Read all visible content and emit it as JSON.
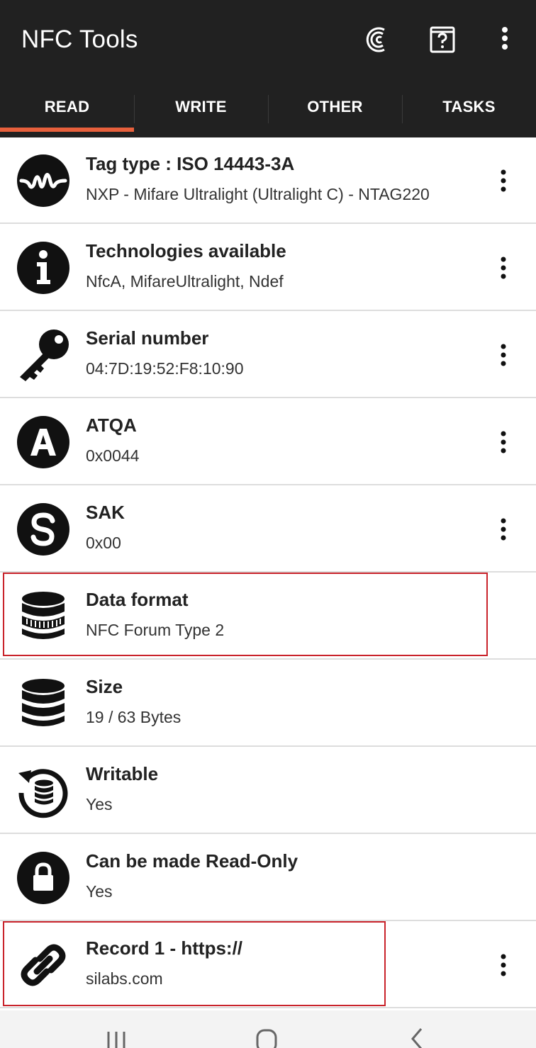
{
  "app": {
    "title": "NFC Tools",
    "accent_color": "#e8603c",
    "appbar_color": "#212121",
    "highlight_color": "#c9232b"
  },
  "toolbar": {
    "icons": [
      "pro-version-icon",
      "help-book-icon",
      "overflow-menu-icon"
    ]
  },
  "tabs": [
    {
      "label": "READ",
      "selected": true
    },
    {
      "label": "WRITE",
      "selected": false
    },
    {
      "label": "OTHER",
      "selected": false
    },
    {
      "label": "TASKS",
      "selected": false
    }
  ],
  "rows": [
    {
      "icon": "waveform-icon",
      "title": "Tag type : ISO 14443-3A",
      "value": "NXP - Mifare Ultralight (Ultralight C) - NTAG220",
      "has_menu": true
    },
    {
      "icon": "info-icon",
      "title": "Technologies available",
      "value": "NfcA, MifareUltralight, Ndef",
      "has_menu": true
    },
    {
      "icon": "key-icon",
      "title": "Serial number",
      "value": "04:7D:19:52:F8:10:90",
      "has_menu": true
    },
    {
      "icon": "letter-a-icon",
      "title": "ATQA",
      "value": "0x0044",
      "has_menu": true
    },
    {
      "icon": "letter-s-icon",
      "title": "SAK",
      "value": "0x00",
      "has_menu": true
    },
    {
      "icon": "database-striped-icon",
      "title": "Data format",
      "value": "NFC Forum Type 2",
      "has_menu": false,
      "highlighted": true
    },
    {
      "icon": "database-icon",
      "title": "Size",
      "value": "19 / 63 Bytes",
      "has_menu": false
    },
    {
      "icon": "rewrite-database-icon",
      "title": "Writable",
      "value": "Yes",
      "has_menu": false
    },
    {
      "icon": "lock-icon",
      "title": "Can be made Read-Only",
      "value": "Yes",
      "has_menu": false
    },
    {
      "icon": "link-icon",
      "title": "Record 1 - https://",
      "value": "silabs.com",
      "has_menu": true,
      "highlighted": true
    }
  ],
  "navbar": {
    "buttons": [
      "recent-apps-icon",
      "home-icon",
      "back-icon"
    ]
  }
}
